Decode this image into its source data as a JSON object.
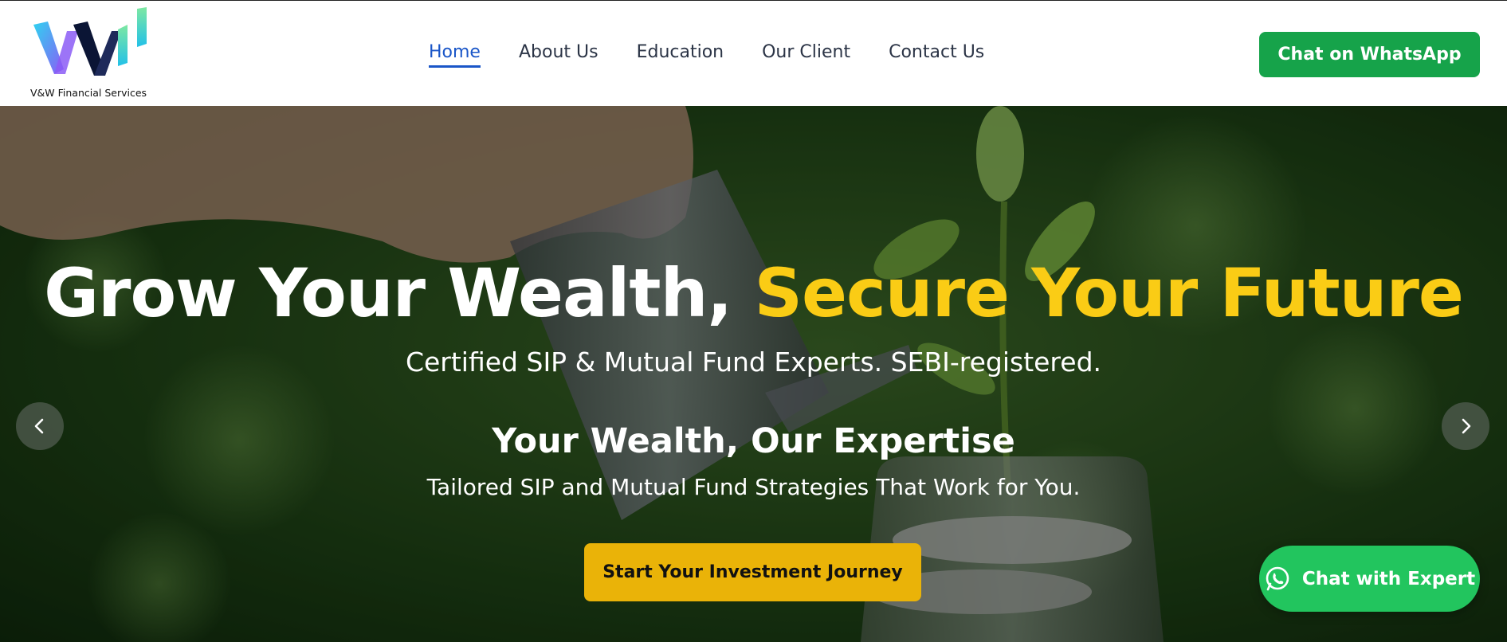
{
  "brand": {
    "name": "V&W Financial Services",
    "logo_icon": "vw-logo-icon"
  },
  "nav": {
    "items": [
      {
        "label": "Home",
        "active": true
      },
      {
        "label": "About Us",
        "active": false
      },
      {
        "label": "Education",
        "active": false
      },
      {
        "label": "Our Client",
        "active": false
      },
      {
        "label": "Contact Us",
        "active": false
      }
    ],
    "whatsapp_button": "Chat on WhatsApp"
  },
  "hero": {
    "title_part1": "Grow Your Wealth,",
    "title_part2": "Secure Your Future",
    "subtitle": "Certified SIP & Mutual Fund Experts. SEBI-registered.",
    "heading2": "Your Wealth, Our Expertise",
    "paragraph": "Tailored SIP and Mutual Fund Strategies That Work for You.",
    "cta": "Start Your Investment Journey",
    "prev_icon": "chevron-left-icon",
    "next_icon": "chevron-right-icon"
  },
  "floating": {
    "chat_expert": "Chat with Expert",
    "icon": "whatsapp-icon"
  },
  "colors": {
    "accent_yellow": "#facc15",
    "cta_yellow": "#eab308",
    "whatsapp_green": "#16a34a",
    "nav_active": "#1a56c8"
  }
}
